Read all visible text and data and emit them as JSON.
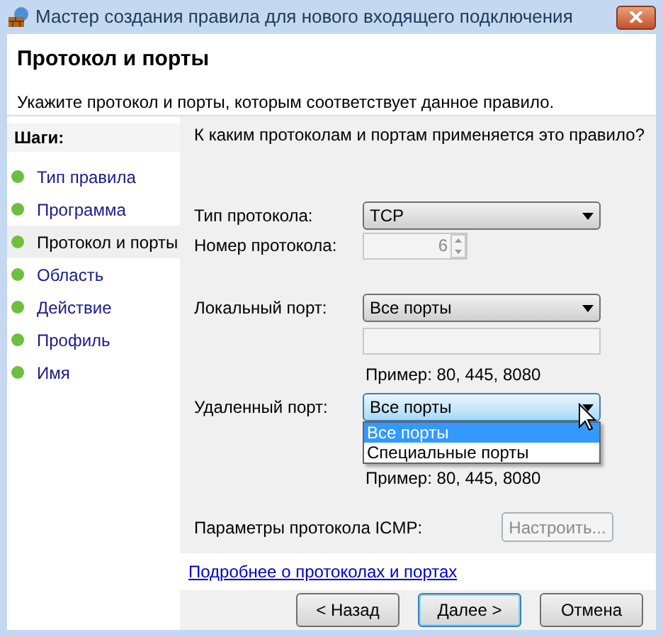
{
  "window": {
    "title": "Мастер создания правила для нового входящего подключения"
  },
  "header": {
    "title": "Протокол и порты",
    "subtitle": "Укажите протокол и порты, которым соответствует данное правило."
  },
  "steps": {
    "label": "Шаги:",
    "items": [
      {
        "label": "Тип правила",
        "selected": false
      },
      {
        "label": "Программа",
        "selected": false
      },
      {
        "label": "Протокол и порты",
        "selected": true
      },
      {
        "label": "Область",
        "selected": false
      },
      {
        "label": "Действие",
        "selected": false
      },
      {
        "label": "Профиль",
        "selected": false
      },
      {
        "label": "Имя",
        "selected": false
      }
    ]
  },
  "question": "К каким протоколам и портам применяется это правило?",
  "protocol_type": {
    "label": "Тип протокола:",
    "value": "TCP"
  },
  "protocol_number": {
    "label": "Номер протокола:",
    "value": "6",
    "disabled": true
  },
  "local_port": {
    "label": "Локальный порт:",
    "value": "Все порты",
    "example": "Пример: 80, 445, 8080"
  },
  "remote_port": {
    "label": "Удаленный порт:",
    "value": "Все порты",
    "expanded": true,
    "options": [
      {
        "label": "Все порты",
        "selected": true
      },
      {
        "label": "Специальные порты",
        "selected": false
      }
    ],
    "example": "Пример: 80, 445, 8080"
  },
  "icmp": {
    "label": "Параметры протокола ICMP:",
    "button": "Настроить...",
    "disabled": true
  },
  "link": "Подробнее о протоколах и портах",
  "buttons": [
    {
      "label": "< Назад",
      "default": false
    },
    {
      "label": "Далее >",
      "default": true
    },
    {
      "label": "Отмена",
      "default": false
    }
  ]
}
